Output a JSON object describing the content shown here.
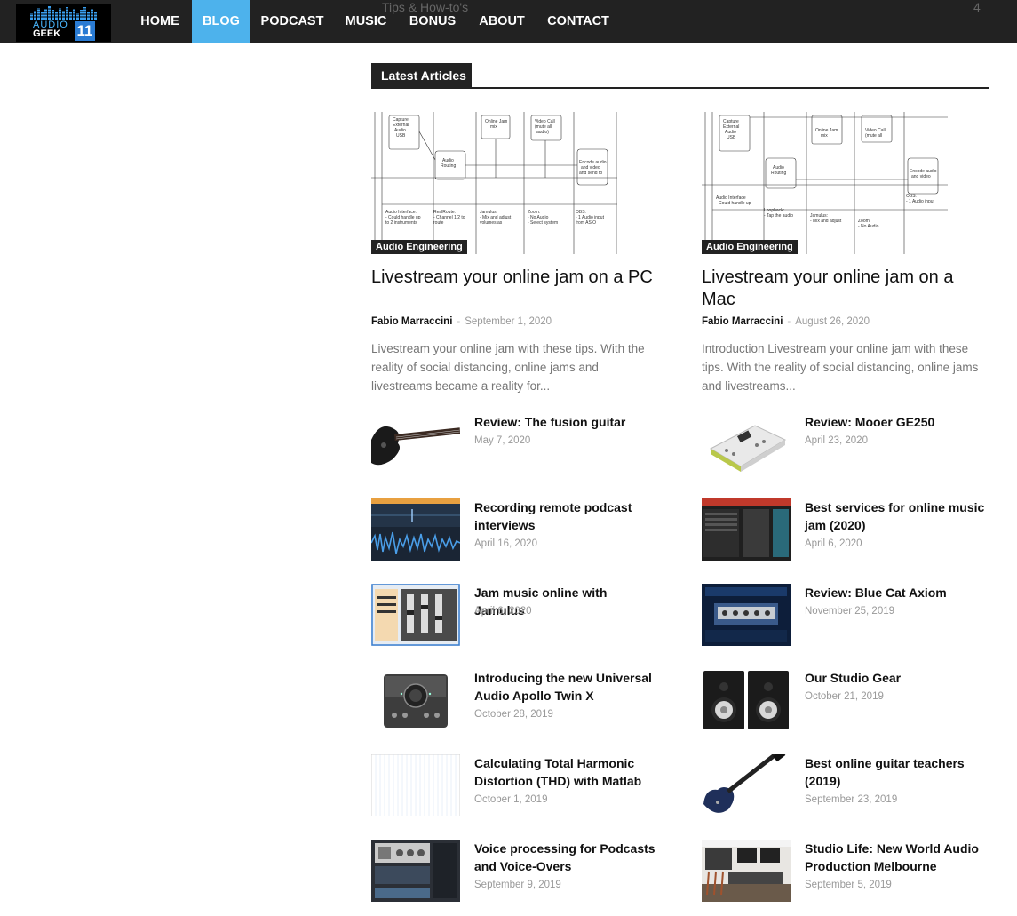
{
  "header": {
    "logo": {
      "top_text": "AUDIO",
      "bottom_text": "GEEK",
      "badge": "11"
    },
    "ghost_text": {
      "left": "Tips & How-to's",
      "right": "4"
    },
    "nav": [
      {
        "label": "HOME"
      },
      {
        "label": "BLOG",
        "active": true
      },
      {
        "label": "PODCAST"
      },
      {
        "label": "MUSIC"
      },
      {
        "label": "BONUS"
      },
      {
        "label": "ABOUT"
      },
      {
        "label": "CONTACT"
      }
    ]
  },
  "section": {
    "title": "Latest Articles"
  },
  "featured": [
    {
      "category": "Audio Engineering",
      "title": "Livestream your online jam on a PC",
      "author": "Fabio Marraccini",
      "date": "September 1, 2020",
      "excerpt": "Livestream your online jam with these tips. With the reality of social distancing, online jams and livestreams became a reality for..."
    },
    {
      "category": "Audio Engineering",
      "title": "Livestream your online jam on a Mac",
      "author": "Fabio Marraccini",
      "date": "August 26, 2020",
      "excerpt": "Introduction Livestream your online jam with these tips. With the reality of social distancing, online jams and livestreams..."
    }
  ],
  "left_list": [
    {
      "title": "Review: The fusion guitar",
      "date": "May 7, 2020",
      "thumb": "guitar-black"
    },
    {
      "title": "Recording remote podcast interviews",
      "date": "April 16, 2020",
      "thumb": "waveform"
    },
    {
      "title": "Jam music online with Jamulus",
      "date": "April 6, 2020",
      "thumb": "mixer-window"
    },
    {
      "title": "Introducing the new Universal Audio Apollo Twin X",
      "date": "October 28, 2019",
      "thumb": "audio-interface"
    },
    {
      "title": "Calculating Total Harmonic Distortion (THD) with Matlab",
      "date": "October 1, 2019",
      "thumb": "plot-grid"
    },
    {
      "title": "Voice processing for Podcasts and Voice-Overs",
      "date": "September 9, 2019",
      "thumb": "plugin-window"
    }
  ],
  "right_list": [
    {
      "title": "Review: Mooer GE250",
      "date": "April 23, 2020",
      "thumb": "multi-effects-pedal"
    },
    {
      "title": "Best services for online music jam (2020)",
      "date": "April 6, 2020",
      "thumb": "dark-app"
    },
    {
      "title": "Review: Blue Cat Axiom",
      "date": "November 25, 2019",
      "thumb": "amp-plugin"
    },
    {
      "title": "Our Studio Gear",
      "date": "October 21, 2019",
      "thumb": "studio-monitors"
    },
    {
      "title": "Best online guitar teachers (2019)",
      "date": "September 23, 2019",
      "thumb": "guitar-blue"
    },
    {
      "title": "Studio Life: New World Audio Production Melbourne",
      "date": "September 5, 2019",
      "thumb": "studio-room"
    }
  ]
}
